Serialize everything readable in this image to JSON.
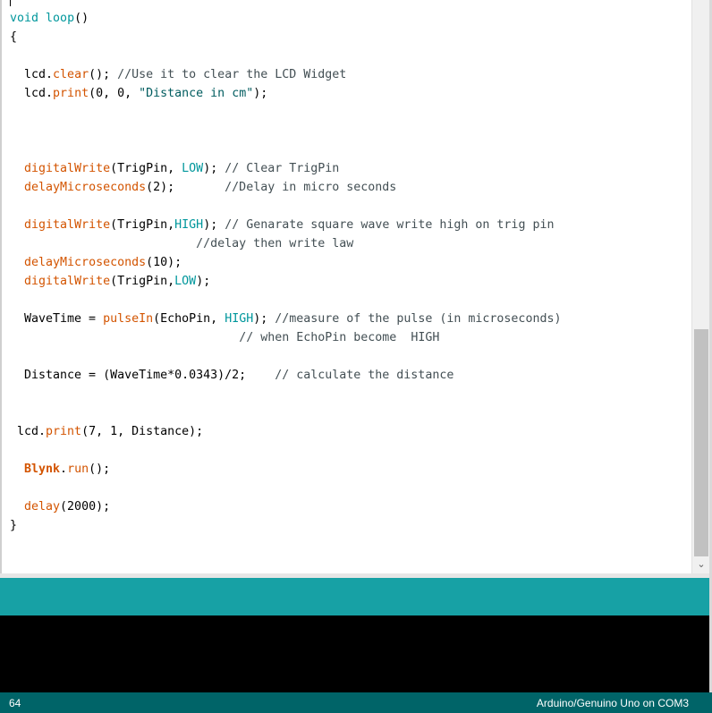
{
  "editor": {
    "lines": [
      [
        {
          "t": "void",
          "c": "kw"
        },
        {
          "t": " "
        },
        {
          "t": "loop",
          "c": "kw"
        },
        {
          "t": "()"
        }
      ],
      [
        {
          "t": "{"
        }
      ],
      [],
      [
        {
          "t": "  lcd."
        },
        {
          "t": "clear",
          "c": "fn"
        },
        {
          "t": "(); "
        },
        {
          "t": "//Use it to clear the LCD Widget",
          "c": "cmt"
        }
      ],
      [
        {
          "t": "  lcd."
        },
        {
          "t": "print",
          "c": "fn"
        },
        {
          "t": "(0, 0, "
        },
        {
          "t": "\"Distance in cm\"",
          "c": "str"
        },
        {
          "t": ");"
        }
      ],
      [],
      [],
      [],
      [
        {
          "t": "  "
        },
        {
          "t": "digitalWrite",
          "c": "fn"
        },
        {
          "t": "(TrigPin, "
        },
        {
          "t": "LOW",
          "c": "kw"
        },
        {
          "t": "); "
        },
        {
          "t": "// Clear TrigPin",
          "c": "cmt"
        }
      ],
      [
        {
          "t": "  "
        },
        {
          "t": "delayMicroseconds",
          "c": "fn"
        },
        {
          "t": "(2);       "
        },
        {
          "t": "//Delay in micro seconds",
          "c": "cmt"
        }
      ],
      [],
      [
        {
          "t": "  "
        },
        {
          "t": "digitalWrite",
          "c": "fn"
        },
        {
          "t": "(TrigPin,"
        },
        {
          "t": "HIGH",
          "c": "kw"
        },
        {
          "t": "); "
        },
        {
          "t": "// Genarate square wave write high on trig pin",
          "c": "cmt"
        }
      ],
      [
        {
          "t": "                          "
        },
        {
          "t": "//delay then write law",
          "c": "cmt"
        }
      ],
      [
        {
          "t": "  "
        },
        {
          "t": "delayMicroseconds",
          "c": "fn"
        },
        {
          "t": "(10);"
        }
      ],
      [
        {
          "t": "  "
        },
        {
          "t": "digitalWrite",
          "c": "fn"
        },
        {
          "t": "(TrigPin,"
        },
        {
          "t": "LOW",
          "c": "kw"
        },
        {
          "t": ");"
        }
      ],
      [],
      [
        {
          "t": "  WaveTime = "
        },
        {
          "t": "pulseIn",
          "c": "fn"
        },
        {
          "t": "(EchoPin, "
        },
        {
          "t": "HIGH",
          "c": "kw"
        },
        {
          "t": "); "
        },
        {
          "t": "//measure of the pulse (in microseconds)",
          "c": "cmt"
        }
      ],
      [
        {
          "t": "                                "
        },
        {
          "t": "// when EchoPin become  HIGH",
          "c": "cmt"
        }
      ],
      [],
      [
        {
          "t": "  Distance = (WaveTime*0.0343)/2;    "
        },
        {
          "t": "// calculate the distance",
          "c": "cmt"
        }
      ],
      [],
      [],
      [
        {
          "t": " lcd."
        },
        {
          "t": "print",
          "c": "fn"
        },
        {
          "t": "(7, 1, Distance);"
        }
      ],
      [],
      [
        {
          "t": "  "
        },
        {
          "t": "Blynk",
          "c": "fn bold"
        },
        {
          "t": "."
        },
        {
          "t": "run",
          "c": "fn"
        },
        {
          "t": "();"
        }
      ],
      [],
      [
        {
          "t": "  "
        },
        {
          "t": "delay",
          "c": "fn"
        },
        {
          "t": "(2000);"
        }
      ],
      [
        {
          "t": "}"
        }
      ]
    ]
  },
  "status": {
    "line_number": "64",
    "board": "Arduino/Genuino Uno on COM3"
  },
  "icons": {
    "scroll_down": "chevron-down-icon"
  },
  "colors": {
    "keyword": "#00979c",
    "function": "#d35400",
    "comment": "#434f54",
    "message_bar": "#17a1a5",
    "status_bar": "#006468",
    "console": "#000000"
  }
}
